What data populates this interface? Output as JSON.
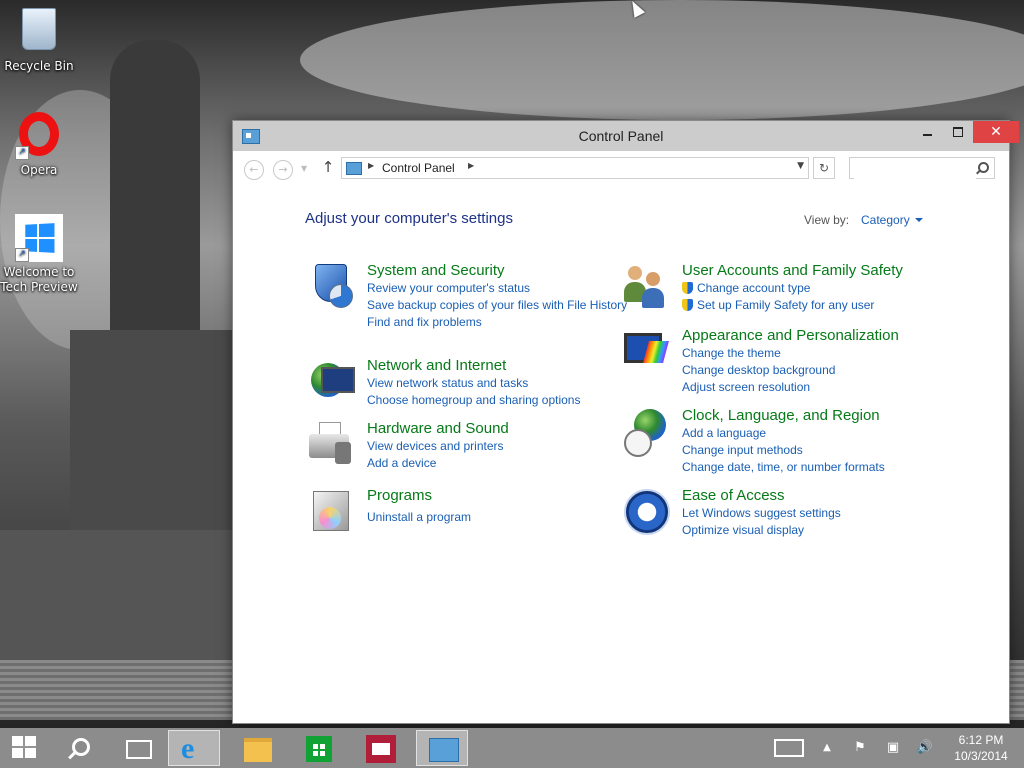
{
  "desktop": {
    "icons": [
      {
        "label": "Recycle Bin"
      },
      {
        "label": "Opera"
      },
      {
        "label": "Welcome to Tech Preview"
      }
    ]
  },
  "window": {
    "title": "Control Panel",
    "controls": {
      "minimize": "",
      "maximize": "",
      "close": "✕"
    },
    "nav": {
      "back": "←",
      "forward": "→",
      "up": "↑",
      "address": "Control Panel",
      "search_placeholder": "",
      "refresh": "↻"
    },
    "heading": "Adjust your computer's settings",
    "view_by_label": "View by:",
    "view_by_value": "Category",
    "categories": [
      {
        "title": "System and Security",
        "icon": "shield-icon",
        "links": [
          "Review your computer's status",
          "Save backup copies of your files with File History",
          "Find and fix problems"
        ]
      },
      {
        "title": "Network and Internet",
        "icon": "network-icon",
        "links": [
          "View network status and tasks",
          "Choose homegroup and sharing options"
        ]
      },
      {
        "title": "Hardware and Sound",
        "icon": "printer-icon",
        "links": [
          "View devices and printers",
          "Add a device"
        ]
      },
      {
        "title": "Programs",
        "icon": "programs-icon",
        "links": [
          "Uninstall a program"
        ]
      },
      {
        "title": "User Accounts and Family Safety",
        "icon": "users-icon",
        "links": [
          "Change account type",
          "Set up Family Safety for any user"
        ]
      },
      {
        "title": "Appearance and Personalization",
        "icon": "appearance-icon",
        "links": [
          "Change the theme",
          "Change desktop background",
          "Adjust screen resolution"
        ]
      },
      {
        "title": "Clock, Language, and Region",
        "icon": "clock-globe-icon",
        "links": [
          "Add a language",
          "Change input methods",
          "Change date, time, or number formats"
        ]
      },
      {
        "title": "Ease of Access",
        "icon": "ease-of-access-icon",
        "links": [
          "Let Windows suggest settings",
          "Optimize visual display"
        ]
      }
    ]
  },
  "taskbar": {
    "items": [
      "start-icon",
      "search-icon",
      "task-view-icon",
      "internet-explorer-icon",
      "file-explorer-icon",
      "store-icon",
      "news-icon",
      "control-panel-icon"
    ],
    "time": "6:12 PM",
    "date": "10/3/2014"
  },
  "colors": {
    "link": "#1a5fb4",
    "category_title": "#067a18",
    "heading": "#1e3287",
    "close_button": "#e04343"
  }
}
